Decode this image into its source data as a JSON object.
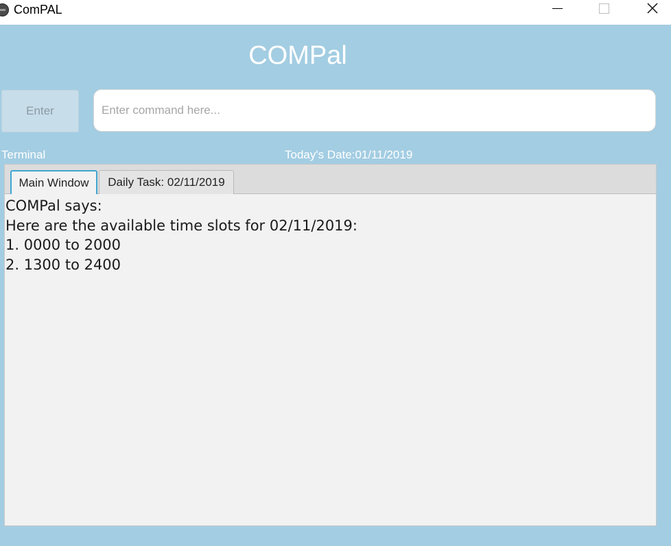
{
  "window": {
    "title": "ComPAL"
  },
  "header": {
    "app_name": "COMPal"
  },
  "command": {
    "enter_label": "Enter",
    "placeholder": "Enter command here...",
    "value": ""
  },
  "status": {
    "terminal_label": "Terminal",
    "date_label": "Today's Date:01/11/2019"
  },
  "tabs": [
    {
      "label": "Main Window",
      "selected": true
    },
    {
      "label": "Daily Task: 02/11/2019",
      "selected": false
    }
  ],
  "output": {
    "lines": [
      "COMPal says:",
      "Here are the available time slots for 02/11/2019:",
      "1. 0000 to 2000",
      "2. 1300 to 2400"
    ]
  },
  "colors": {
    "background": "#a3cde2",
    "selected_tab_accent": "#3fa6cf"
  }
}
